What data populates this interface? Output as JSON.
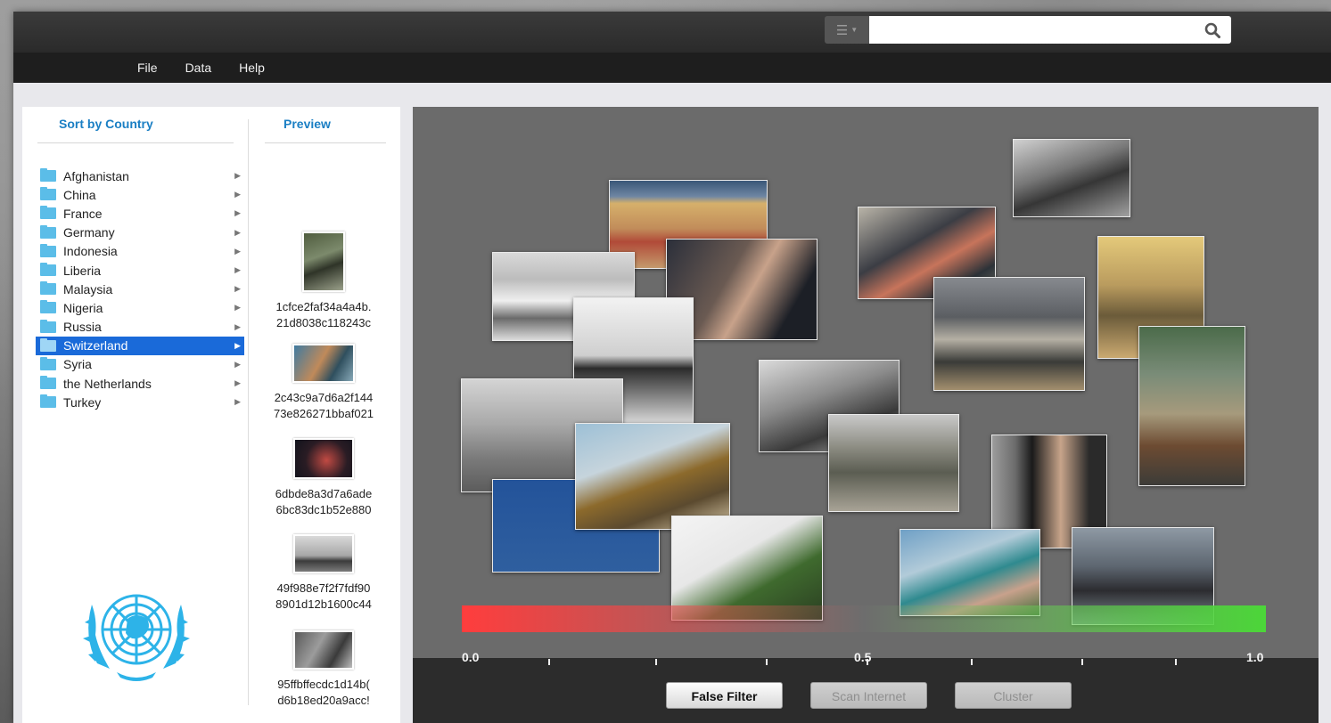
{
  "menubar": {
    "items": [
      "File",
      "Data",
      "Help"
    ]
  },
  "search": {
    "value": "",
    "placeholder": ""
  },
  "left_panel": {
    "sort_header": "Sort by Country",
    "preview_header": "Preview",
    "countries": [
      "Afghanistan",
      "China",
      "France",
      "Germany",
      "Indonesia",
      "Liberia",
      "Malaysia",
      "Nigeria",
      "Russia",
      "Switzerland",
      "Syria",
      "the Netherlands",
      "Turkey"
    ],
    "selected_country": "Switzerland",
    "previews": [
      {
        "line1": "1cfce2faf34a4a4b.",
        "line2": "21d8038c118243c"
      },
      {
        "line1": "2c43c9a7d6a2f144",
        "line2": "73e826271bbaf021"
      },
      {
        "line1": "6dbde8a3d7a6ade",
        "line2": "6bc83dc1b52e880"
      },
      {
        "line1": "49f988e7f2f7fdf90",
        "line2": "8901d12b1600c44"
      },
      {
        "line1": "95ffbffecdc1d14b(",
        "line2": "d6b18ed20a9acc!"
      }
    ]
  },
  "scale": {
    "labels": [
      "0.0",
      "0.5",
      "1.0"
    ],
    "color_low": "#ff3d3d",
    "color_high": "#4cd639"
  },
  "buttons": {
    "false_filter": "False Filter",
    "scan_internet": "Scan Internet",
    "cluster": "Cluster"
  },
  "colors": {
    "accent": "#1b7fc4",
    "selection": "#1a6ad9",
    "folder": "#5bbde8"
  }
}
